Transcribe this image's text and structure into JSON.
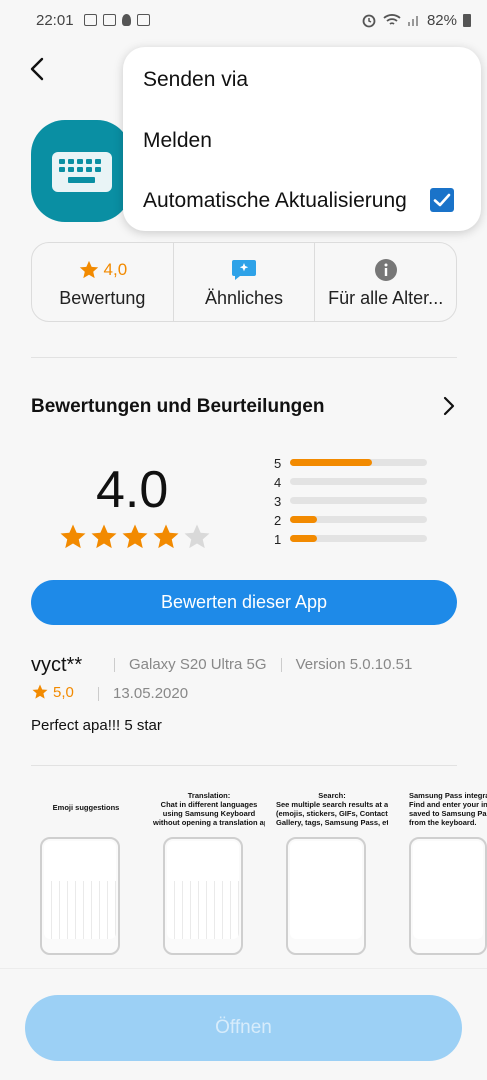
{
  "status_bar": {
    "time": "22:01",
    "battery": "82%",
    "left_icons": [
      "email-icon",
      "image-icon",
      "bulb-icon",
      "email-icon"
    ],
    "right_icons": [
      "alarm-icon",
      "wifi-icon",
      "signal-icon",
      "battery-icon"
    ]
  },
  "overflow_menu": {
    "items": [
      "Senden via",
      "Melden",
      "Automatische Aktualisierung"
    ],
    "auto_update_checked": true
  },
  "info_bar": {
    "rating_value": "4,0",
    "rating_label": "Bewertung",
    "similar_label": "Ähnliches",
    "age_label": "Für alle Alter..."
  },
  "ratings_section": {
    "title": "Bewertungen und Beurteilungen",
    "average": "4.0",
    "stars_filled": 4,
    "stars_total": 5,
    "distribution": [
      {
        "stars": "5",
        "fraction": 0.6
      },
      {
        "stars": "4",
        "fraction": 0.0
      },
      {
        "stars": "3",
        "fraction": 0.0
      },
      {
        "stars": "2",
        "fraction": 0.2
      },
      {
        "stars": "1",
        "fraction": 0.2
      }
    ],
    "rate_button": "Bewerten dieser App"
  },
  "review": {
    "user": "vyct**",
    "device": "Galaxy S20 Ultra 5G",
    "version": "Version 5.0.10.51",
    "rating": "5,0",
    "date": "13.05.2020",
    "text": "Perfect apa!!! 5 star"
  },
  "screenshots": [
    {
      "caption": "Emoji suggestions"
    },
    {
      "caption": "Translation:\nChat in different languages\nusing Samsung Keyboard\nwithout opening a translation app."
    },
    {
      "caption": "Search:\nSee multiple search results at a glance\n(emojis, stickers, GIFs, Contacts,\nGallery, tags, Samsung Pass, etc.)."
    },
    {
      "caption": "Samsung Pass integrat\nFind and enter your inform\nsaved to Samsung Pass di\nfrom the keyboard."
    }
  ],
  "open_button": "Öffnen",
  "colors": {
    "accent_blue": "#1e8ae8",
    "star_orange": "#f28a00",
    "app_icon_teal": "#0a8fa3",
    "disabled_button": "#9cd0f5"
  }
}
